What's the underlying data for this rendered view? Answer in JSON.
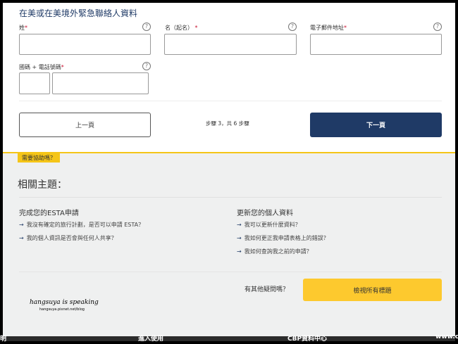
{
  "form": {
    "title": "在美或在美境外緊急聯絡人資料",
    "fields": [
      {
        "label": "姓",
        "required": "*"
      },
      {
        "label": "名（起名）",
        "required": "*"
      },
      {
        "label": "電子郵件地址",
        "required": "*"
      },
      {
        "label": "國碼 + 電話號碼",
        "required": "*"
      }
    ],
    "help_icon": "?"
  },
  "nav": {
    "prev": "上一頁",
    "step": "步驟 3，共 6 步驟",
    "next": "下一頁"
  },
  "help": {
    "tab": "需要協助嗎？",
    "heading": "相關主題：",
    "col1": {
      "title": "完成您的ESTA申請",
      "links": [
        "我沒有確定的旅行計劃，是否可以申請 ESTA？",
        "我的個人資訊是否會與任何人共享？"
      ]
    },
    "col2": {
      "title": "更新您的個人資料",
      "links": [
        "我可以更新什麼資料？",
        "我如何更正我申請表格上的錯誤？",
        "我如何查詢我之前的申請？"
      ]
    },
    "other_q": "有其他疑問嗎？",
    "view_all": "檢視所有標題",
    "arrow": "→"
  },
  "watermark": {
    "line1": "hangsuya is speaking",
    "line2": "hangsuya.pixnet.net/blog"
  },
  "footer": {
    "items": [
      "明",
      "進入使用",
      "CBP資料中心",
      "www.c"
    ]
  },
  "colors": {
    "navy": "#1f3a66",
    "yellow": "#fdc92e",
    "footer": "#2b2b2b"
  }
}
